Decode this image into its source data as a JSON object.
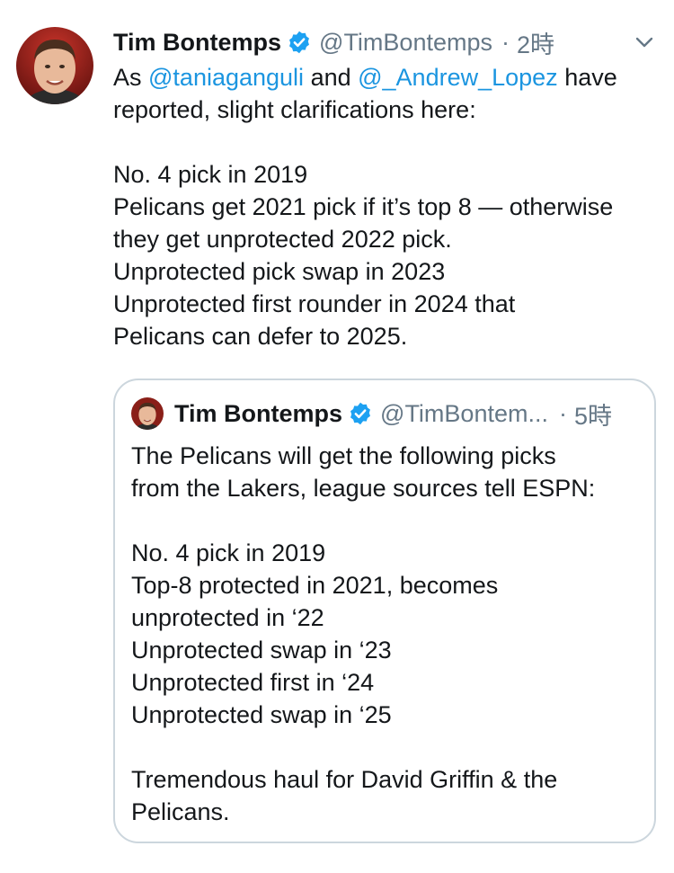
{
  "tweet": {
    "author": {
      "name": "Tim Bontemps",
      "handle": "@TimBontemps",
      "verified": true
    },
    "separator": "·",
    "time": "2時",
    "text_lines": [
      {
        "parts": [
          "As ",
          "@taniaganguli",
          " and ",
          "@_Andrew_Lopez",
          " have"
        ]
      },
      {
        "text": "reported, slight clarifications here:"
      },
      {
        "text": ""
      },
      {
        "text": "No. 4 pick in 2019"
      },
      {
        "text": "Pelicans get 2021 pick if it’s top 8 — otherwise"
      },
      {
        "text": "they get unprotected 2022 pick."
      },
      {
        "text": "Unprotected pick swap in 2023"
      },
      {
        "text": "Unprotected first rounder in 2024 that"
      },
      {
        "text": "Pelicans can defer to 2025."
      }
    ]
  },
  "quoted_tweet": {
    "author": {
      "name": "Tim Bontemps",
      "handle": "@TimBontem...",
      "verified": true
    },
    "separator": "·",
    "time": "5時",
    "text_lines": [
      "The Pelicans will get the following picks",
      "from the Lakers, league sources tell ESPN:",
      "",
      "No. 4 pick in 2019",
      "Top-8 protected in 2021, becomes",
      "unprotected in ‘22",
      "Unprotected swap in ‘23",
      "Unprotected first in ‘24",
      "Unprotected swap in ‘25",
      "",
      "Tremendous haul for David Griffin & the",
      "Pelicans."
    ]
  },
  "icons": {
    "verified": "verified-badge-icon",
    "menu": "chevron-down-icon"
  },
  "colors": {
    "link": "#1b95e0",
    "verified": "#1da1f2",
    "secondary_text": "#657786",
    "border": "#ccd6dd"
  }
}
